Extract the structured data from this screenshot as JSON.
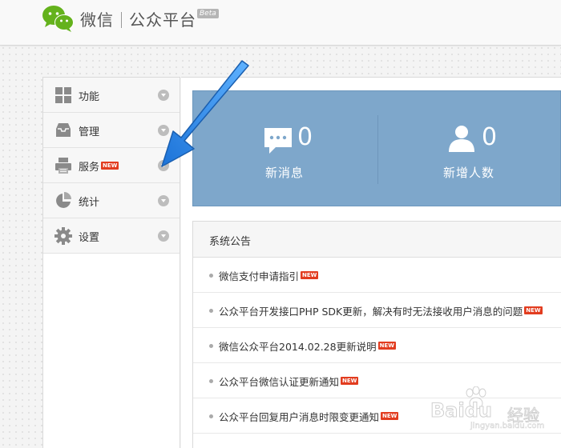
{
  "header": {
    "brand_left": "微信",
    "brand_right": "公众平台",
    "beta": "Beta"
  },
  "sidebar": {
    "items": [
      {
        "label": "功能",
        "icon": "grid-icon",
        "new": false
      },
      {
        "label": "管理",
        "icon": "inbox-icon",
        "new": false
      },
      {
        "label": "服务",
        "icon": "printer-icon",
        "new": true,
        "badge": "NEW"
      },
      {
        "label": "统计",
        "icon": "pie-chart-icon",
        "new": false
      },
      {
        "label": "设置",
        "icon": "gear-icon",
        "new": false
      }
    ]
  },
  "stats": {
    "messages": {
      "value": "0",
      "label": "新消息",
      "icon": "chat-bubble-icon"
    },
    "followers": {
      "value": "0",
      "label": "新增人数",
      "icon": "user-icon"
    }
  },
  "notices": {
    "title": "系统公告",
    "badge": "NEW",
    "items": [
      {
        "text": "微信支付申请指引"
      },
      {
        "text": "公众平台开发接口PHP SDK更新，解决有时无法接收用户消息的问题"
      },
      {
        "text": "微信公众平台2014.02.28更新说明"
      },
      {
        "text": "公众平台微信认证更新通知"
      },
      {
        "text": "公众平台回复用户消息时限变更通知"
      }
    ]
  },
  "watermark": {
    "brand": "Bai",
    "brand_tail": "du",
    "product": "经验",
    "url": "jingyan.baidu.com"
  },
  "colors": {
    "stats_bg": "#7ea7cb",
    "wechat_green": "#64b21c",
    "new_badge": "#e23c1f",
    "annotation_arrow": "#2a86e8"
  }
}
